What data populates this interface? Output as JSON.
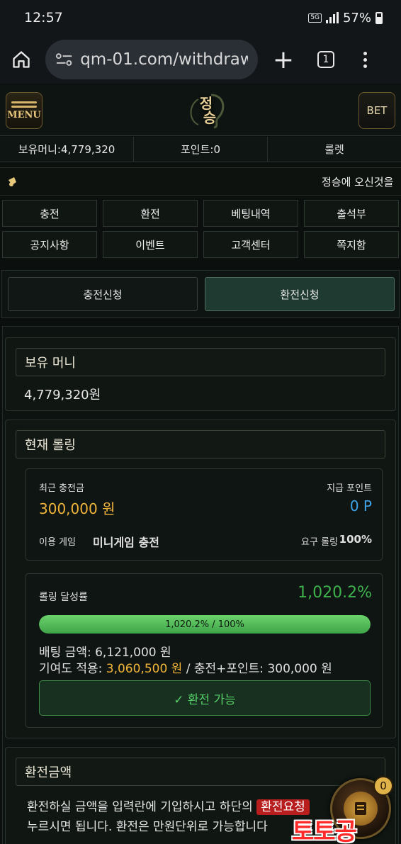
{
  "status_bar": {
    "time": "12:57",
    "network": "5G",
    "battery": "57%"
  },
  "browser": {
    "url": "qm-01.com/withdraw",
    "tab_count": "1"
  },
  "header": {
    "menu_label": "MENU",
    "logo_line1": "정",
    "logo_line2": "승",
    "bet_label": "BET"
  },
  "balance_bar": {
    "money": "보유머니:4,779,320",
    "points": "포인트:0",
    "roulette": "룰렛"
  },
  "marquee": {
    "text": "정승에 오신것을"
  },
  "nav": [
    "충전",
    "환전",
    "베팅내역",
    "출석부",
    "공지사항",
    "이벤트",
    "고객센터",
    "쪽지함"
  ],
  "request_tabs": {
    "deposit": "충전신청",
    "withdraw": "환전신청"
  },
  "holdings": {
    "title": "보유 머니",
    "amount": "4,779,320원"
  },
  "rolling": {
    "title": "현재 롤링",
    "recent_deposit_label": "최근 충전금",
    "recent_deposit_value": "300,000 원",
    "points_label": "지급 포인트",
    "points_value": "0 P",
    "game_label": "이용 게임",
    "game_value": "미니게임 충전",
    "required_label": "요구 롤링",
    "required_value": "100%",
    "rate_label": "롤링 달성률",
    "rate_value": "1,020.2%",
    "progress_text": "1,020.2% / 100%",
    "progress_fraction": 1.0,
    "bet_amount_text": "배팅 금액: 6,121,000 원",
    "contribution_label": "기여도 적용: ",
    "contribution_value": "3,060,500 원",
    "contribution_tail": " / 충전+포인트: 300,000 원",
    "available_label": "✓ 환전 가능"
  },
  "withdraw_amount": {
    "title": "환전금액",
    "desc_line1_a": "환전하실 금액을 입력란에 기입하시고 하단의",
    "desc_badge": "환전요청",
    "desc_line2": "누르시면 됩니다. 환전은 만원단위로 가능합니다"
  },
  "float_widget": {
    "badge": "0"
  },
  "watermark": "토토공",
  "colors": {
    "accent_gold": "#f1b43a",
    "accent_green": "#3fb24d",
    "accent_blue": "#3fa4ea"
  }
}
